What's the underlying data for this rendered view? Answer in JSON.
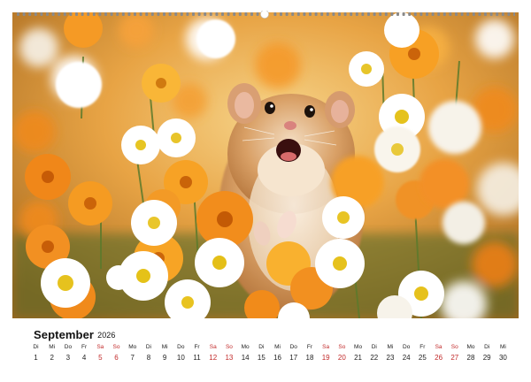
{
  "calendar": {
    "month": "September",
    "year": "2026",
    "weekdays": [
      "Di",
      "Mi",
      "Do",
      "Fr",
      "Sa",
      "So",
      "Mo",
      "Di",
      "Mi",
      "Do",
      "Fr",
      "Sa",
      "So",
      "Mo",
      "Di",
      "Mi",
      "Do",
      "Fr",
      "Sa",
      "So",
      "Mo",
      "Di",
      "Mi",
      "Do",
      "Fr",
      "Sa",
      "So",
      "Mo",
      "Di",
      "Mi"
    ],
    "dates": [
      "1",
      "2",
      "3",
      "4",
      "5",
      "6",
      "7",
      "8",
      "9",
      "10",
      "11",
      "12",
      "13",
      "14",
      "15",
      "16",
      "17",
      "18",
      "19",
      "20",
      "21",
      "22",
      "23",
      "24",
      "25",
      "26",
      "27",
      "28",
      "29",
      "30"
    ],
    "weekend_indices": [
      4,
      5,
      11,
      12,
      18,
      19,
      25,
      26
    ],
    "weekend_color": "#c22b2b",
    "text_color": "#222222"
  },
  "photo": {
    "subject": "hamster-among-flowers",
    "icons": [
      "hamster-icon",
      "orange-flower-icon",
      "daisy-icon"
    ]
  }
}
